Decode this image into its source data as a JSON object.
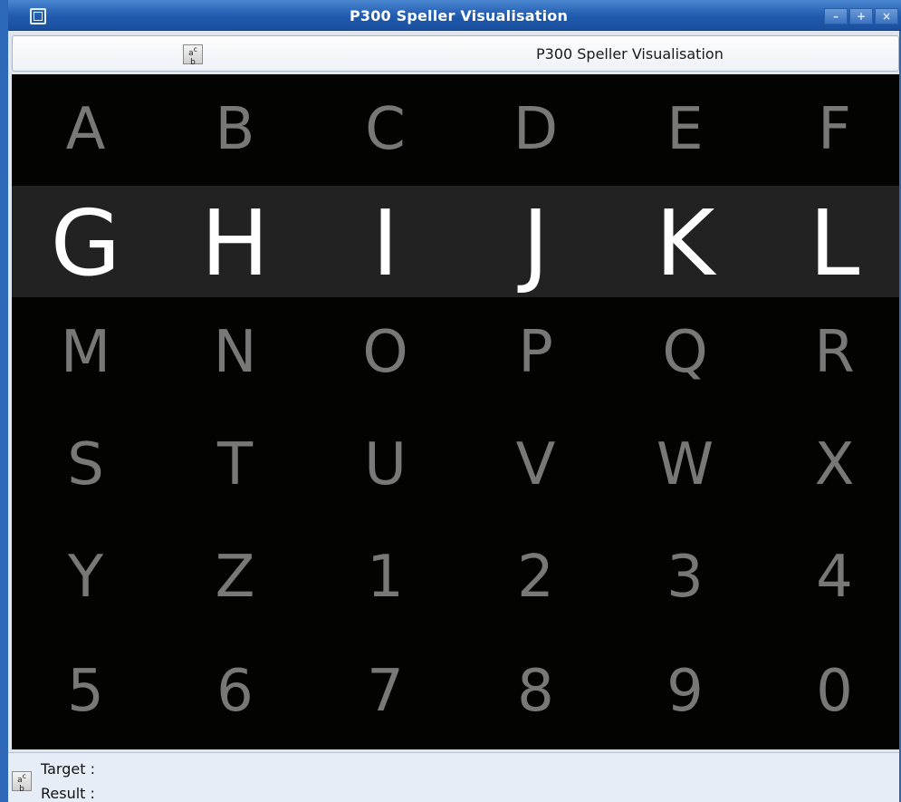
{
  "window": {
    "title": "P300 Speller Visualisation",
    "buttons": {
      "minimize": "–",
      "maximize": "+",
      "close": "×"
    }
  },
  "toolbar": {
    "icon": "font-icon",
    "title": "P300 Speller Visualisation"
  },
  "speller": {
    "highlighted_row": 1,
    "rows": [
      [
        "A",
        "B",
        "C",
        "D",
        "E",
        "F"
      ],
      [
        "G",
        "H",
        "I",
        "J",
        "K",
        "L"
      ],
      [
        "M",
        "N",
        "O",
        "P",
        "Q",
        "R"
      ],
      [
        "S",
        "T",
        "U",
        "V",
        "W",
        "X"
      ],
      [
        "Y",
        "Z",
        "1",
        "2",
        "3",
        "4"
      ],
      [
        "5",
        "6",
        "7",
        "8",
        "9",
        "0"
      ]
    ],
    "colors": {
      "background": "#030302",
      "highlight_band": "#222222",
      "normal_text": "#787878",
      "highlight_text": "#ffffff"
    }
  },
  "status": {
    "target_label": "Target :",
    "result_label": "Result :"
  }
}
